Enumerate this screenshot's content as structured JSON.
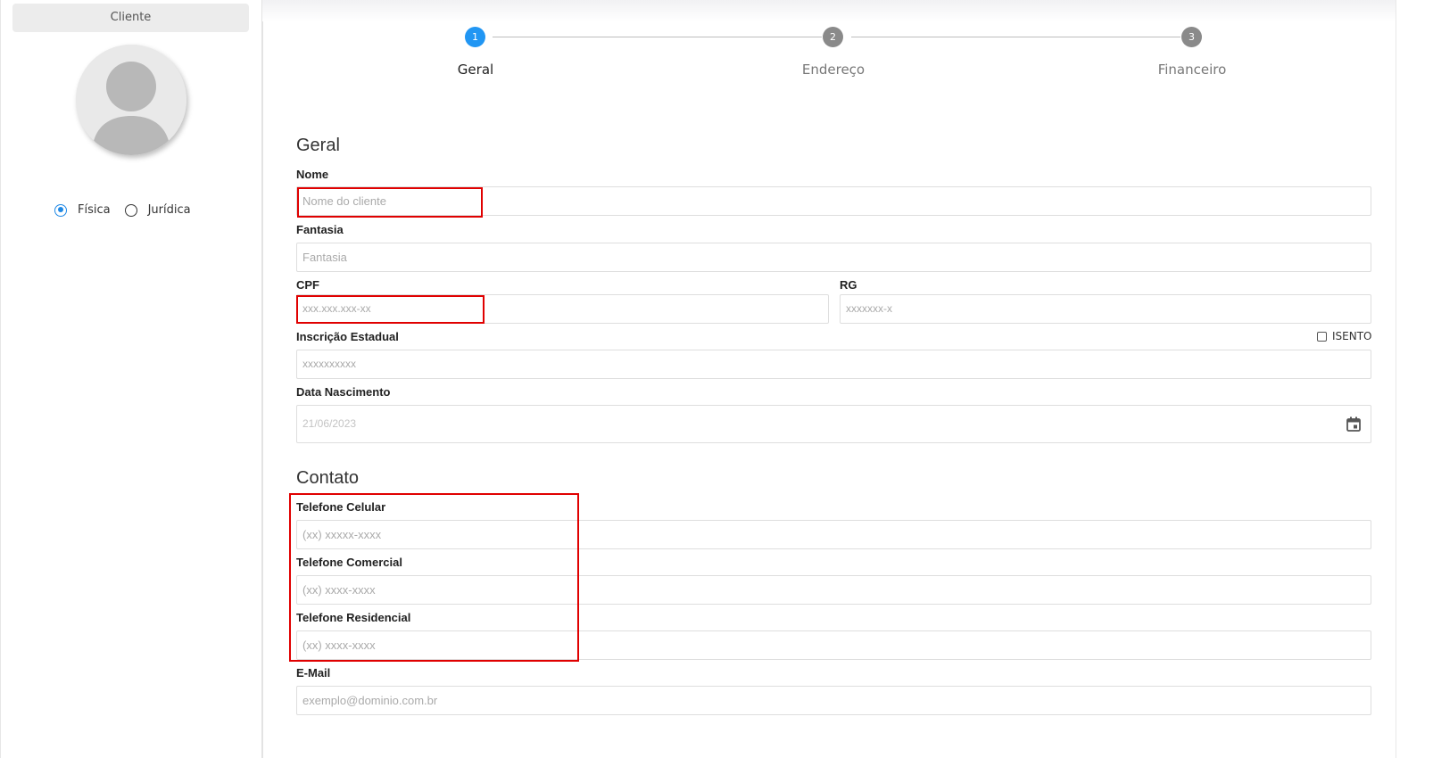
{
  "sidebar": {
    "tab_label": "Cliente",
    "person_type": {
      "options": [
        {
          "label": "Física",
          "checked": true
        },
        {
          "label": "Jurídica",
          "checked": false
        }
      ]
    }
  },
  "stepper": {
    "steps": [
      {
        "number": "1",
        "label": "Geral",
        "active": true
      },
      {
        "number": "2",
        "label": "Endereço",
        "active": false
      },
      {
        "number": "3",
        "label": "Financeiro",
        "active": false
      }
    ]
  },
  "geral": {
    "title": "Geral",
    "nome_label": "Nome",
    "nome_placeholder": "Nome do cliente",
    "fantasia_label": "Fantasia",
    "fantasia_placeholder": "Fantasia",
    "cpf_label": "CPF",
    "cpf_placeholder": "xxx.xxx.xxx-xx",
    "rg_label": "RG",
    "rg_placeholder": "xxxxxxx-x",
    "ie_label": "Inscrição Estadual",
    "ie_placeholder": "xxxxxxxxxx",
    "isento_label": "ISENTO",
    "data_nasc_label": "Data Nascimento",
    "data_nasc_value": "21/06/2023"
  },
  "contato": {
    "title": "Contato",
    "cel_label": "Telefone Celular",
    "cel_placeholder": "(xx) xxxxx-xxxx",
    "com_label": "Telefone Comercial",
    "com_placeholder": "(xx) xxxx-xxxx",
    "res_label": "Telefone Residencial",
    "res_placeholder": "(xx) xxxx-xxxx",
    "email_label": "E-Mail",
    "email_placeholder": "exemplo@dominio.com.br"
  },
  "colors": {
    "accent": "#2196f3",
    "step_inactive": "#8a8a8a",
    "highlight": "#e00000"
  },
  "icons": [
    "user-avatar-icon",
    "calendar-icon"
  ]
}
